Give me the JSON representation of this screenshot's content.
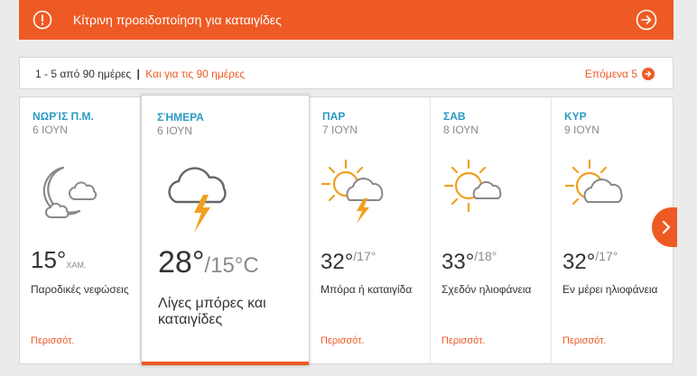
{
  "alert": {
    "text": "Κίτρινη προειδοποίηση για καταιγίδες"
  },
  "range": {
    "summary": "1 - 5 από 90 ημέρες",
    "separator": "|",
    "all_link": "Και για τις 90 ημέρες",
    "next_label": "Επόμενα 5"
  },
  "days": [
    {
      "name": "ΝΩΡΊΣ Π.Μ.",
      "date": "6 ΙΟΥΝ",
      "temp": "15°",
      "temp_sub": "ΧΑΜ.",
      "condition": "Παροδικές νεφώσεις",
      "more": "Περισσότ.",
      "icon": "night-cloud-icon"
    },
    {
      "name": "ΣΉΜΕΡΑ",
      "date": "6 ΙΟΥΝ",
      "temp_high": "28°",
      "temp_low": "/15°C",
      "condition": "Λίγες μπόρες και καταιγίδες",
      "icon": "thunder-cloud-icon"
    },
    {
      "name": "ΠΑΡ",
      "date": "7 ΙΟΥΝ",
      "temp_high": "32°",
      "temp_low": "/17°",
      "condition": "Μπόρα ή καταιγίδα",
      "more": "Περισσότ.",
      "icon": "sun-thunder-icon"
    },
    {
      "name": "ΣΑΒ",
      "date": "8 ΙΟΥΝ",
      "temp_high": "33°",
      "temp_low": "/18°",
      "condition": "Σχεδόν ηλιοφάνεια",
      "more": "Περισσότ.",
      "icon": "mostly-sunny-icon"
    },
    {
      "name": "ΚΥΡ",
      "date": "9 ΙΟΥΝ",
      "temp_high": "32°",
      "temp_low": "/17°",
      "condition": "Εν μέρει ηλιοφάνεια",
      "more": "Περισσότ.",
      "icon": "partly-sunny-icon"
    }
  ],
  "colors": {
    "accent": "#ee5a24",
    "day_label": "#2a9bc4"
  }
}
